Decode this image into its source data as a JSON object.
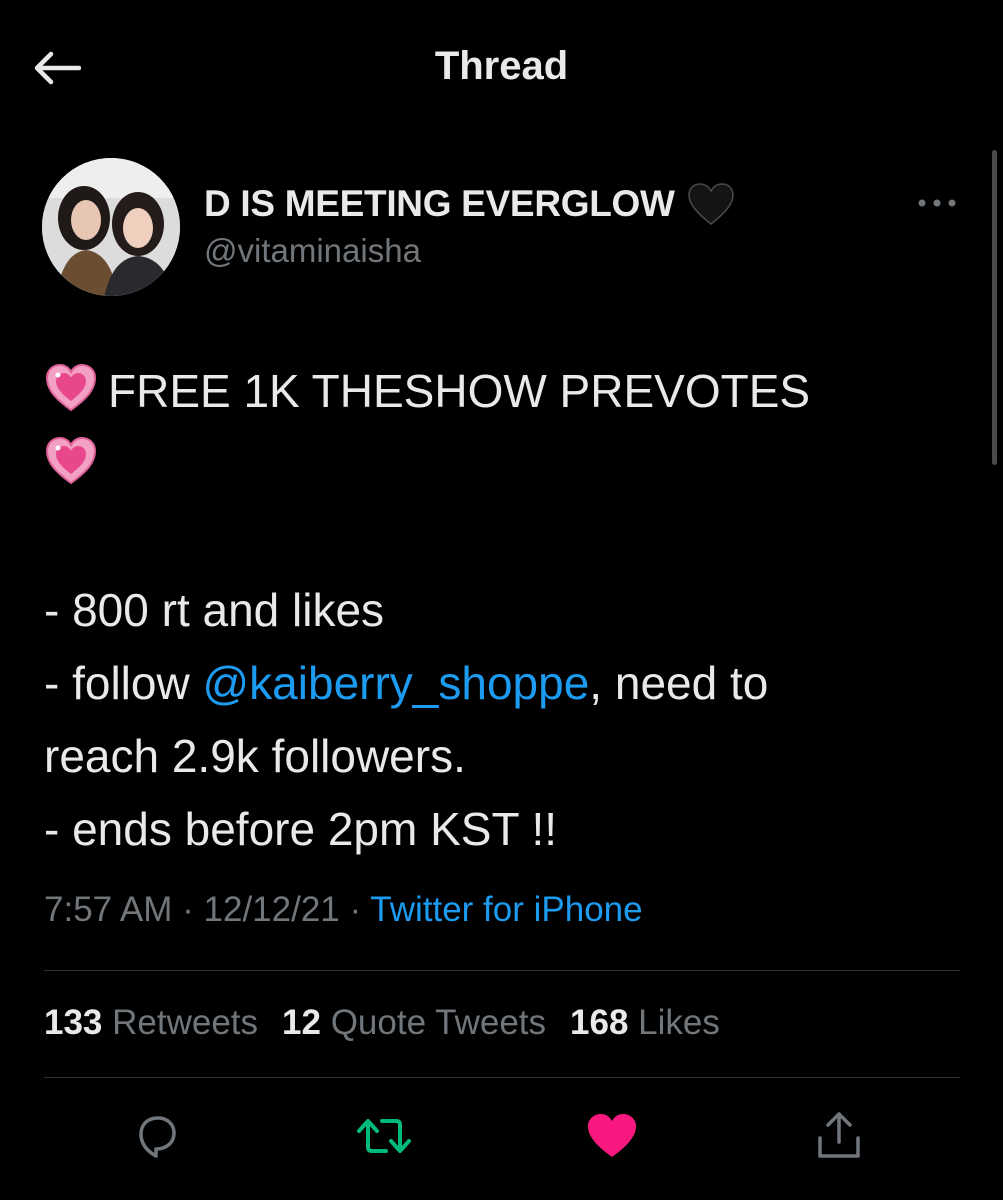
{
  "header": {
    "title": "Thread",
    "back_icon": "back-arrow-icon"
  },
  "tweet": {
    "author": {
      "display_name": "D IS MEETING EVERGLOW",
      "name_emoji": "black-heart-icon",
      "handle": "@vitaminaisha"
    },
    "body": {
      "line1_emoji": "sparkling-heart-icon",
      "line1_text": "FREE 1K THESHOW PREVOTES",
      "line2_emoji": "sparkling-heart-icon",
      "req1": "- 800 rt and likes",
      "req2_prefix": "- follow ",
      "req2_mention": "@kaiberry_shoppe",
      "req2_suffix": ", need to",
      "req2_cont": "reach 2.9k followers.",
      "req3": "- ends before 2pm KST !!"
    },
    "meta": {
      "time": "7:57 AM",
      "sep1": " · ",
      "date": "12/12/21",
      "sep2": " · ",
      "source": "Twitter for iPhone"
    },
    "stats": {
      "retweets_count": "133",
      "retweets_label": " Retweets",
      "quotes_count": "12",
      "quotes_label": " Quote Tweets",
      "likes_count": "168",
      "likes_label": " Likes"
    },
    "actions": {
      "reply_icon": "reply-icon",
      "retweet_icon": "retweet-icon",
      "like_icon": "heart-icon",
      "share_icon": "share-icon"
    }
  },
  "colors": {
    "background": "#000000",
    "text": "#e7e9ea",
    "secondary": "#71767b",
    "link": "#1d9bf0",
    "retweet_active": "#00ba7c",
    "like_active": "#f91880",
    "divider": "#2f3336"
  }
}
